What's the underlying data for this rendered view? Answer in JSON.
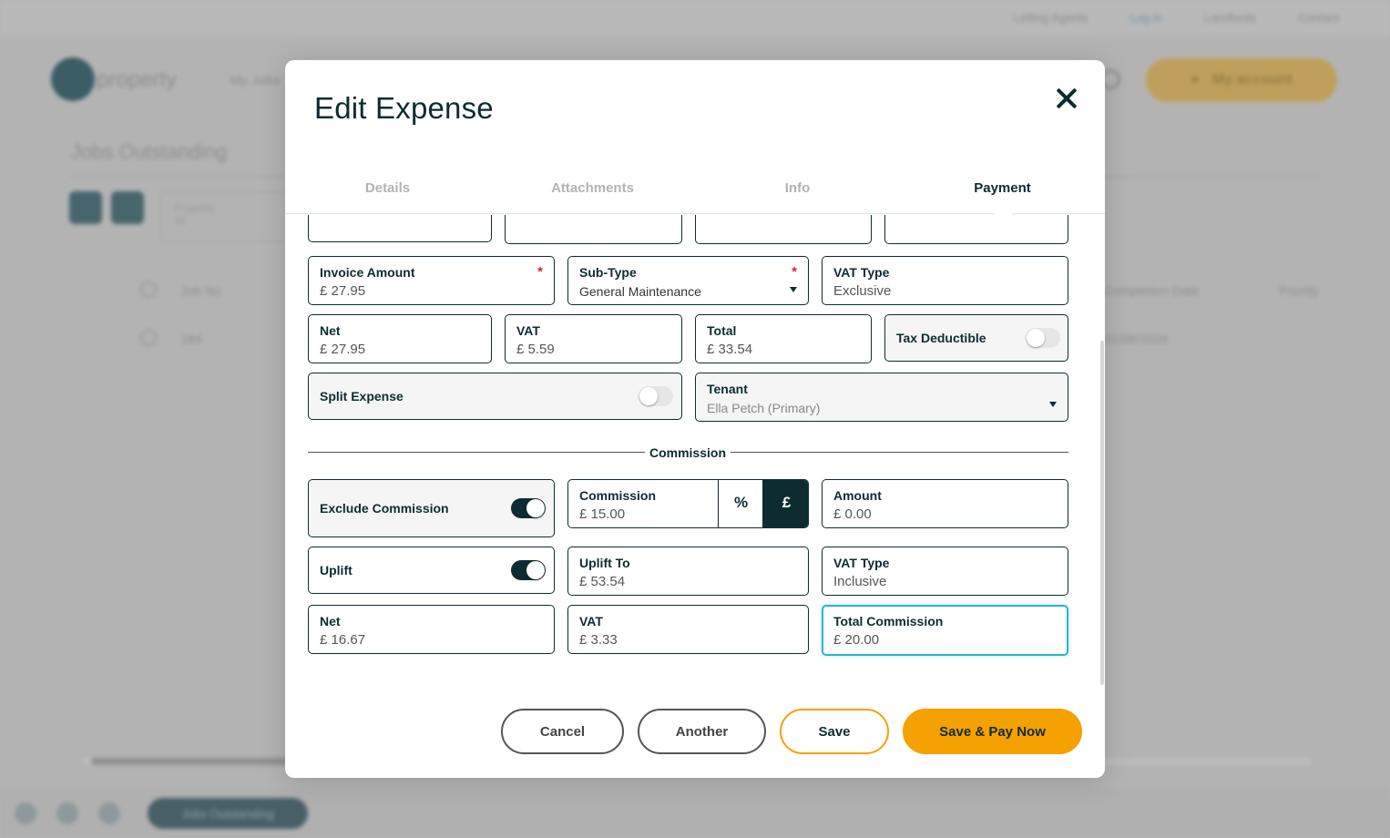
{
  "background": {
    "top_links": [
      "Letting Agents",
      "Log in",
      "Landlords",
      "Contact"
    ],
    "logo_text": "property",
    "nav_text": "My Jobs",
    "account_label": "My account",
    "page_title": "Jobs Outstanding",
    "filter_label": "Property",
    "filter_value": "All",
    "columns": {
      "job_no": "Job No",
      "completion_date": "Completion Date",
      "priority": "Priority"
    },
    "row": {
      "job_no": "184",
      "date": "01/08/2024"
    },
    "bottom_pill": "Jobs Outstanding"
  },
  "modal": {
    "title": "Edit Expense",
    "tabs": [
      "Details",
      "Attachments",
      "Info",
      "Payment"
    ],
    "active_tab": "Payment",
    "invoice_amount": {
      "label": "Invoice Amount",
      "value": "£ 27.95",
      "required_mark": "*"
    },
    "sub_type": {
      "label": "Sub-Type",
      "value": "General Maintenance",
      "required_mark": "*"
    },
    "vat_type": {
      "label": "VAT Type",
      "value": "Exclusive"
    },
    "net": {
      "label": "Net",
      "value": "£ 27.95"
    },
    "vat": {
      "label": "VAT",
      "value": "£ 5.59"
    },
    "total": {
      "label": "Total",
      "value": "£ 33.54"
    },
    "tax_deductible": {
      "label": "Tax Deductible",
      "on": false
    },
    "split_expense": {
      "label": "Split Expense",
      "on": false
    },
    "tenant": {
      "label": "Tenant",
      "value": "Ella Petch (Primary)"
    },
    "commission_section": "Commission",
    "exclude_commission": {
      "label": "Exclude Commission",
      "on": true
    },
    "commission": {
      "label": "Commission",
      "value": "£ 15.00",
      "percent_symbol": "%",
      "pound_symbol": "£",
      "mode": "pound"
    },
    "amount": {
      "label": "Amount",
      "value": "£ 0.00"
    },
    "uplift": {
      "label": "Uplift",
      "on": true
    },
    "uplift_to": {
      "label": "Uplift To",
      "value": "£ 53.54"
    },
    "vat_type_commission": {
      "label": "VAT Type",
      "value": "Inclusive"
    },
    "commission_net": {
      "label": "Net",
      "value": "£ 16.67"
    },
    "commission_vat": {
      "label": "VAT",
      "value": "£ 3.33"
    },
    "total_commission": {
      "label": "Total Commission",
      "value": "£ 20.00"
    },
    "buttons": {
      "cancel": "Cancel",
      "another": "Another",
      "save": "Save",
      "save_pay": "Save & Pay Now"
    }
  },
  "colors": {
    "primary_dark": "#0d2c31",
    "accent_orange": "#f5a100",
    "focus_blue": "#28b5d6",
    "required_red": "#d9262c"
  }
}
